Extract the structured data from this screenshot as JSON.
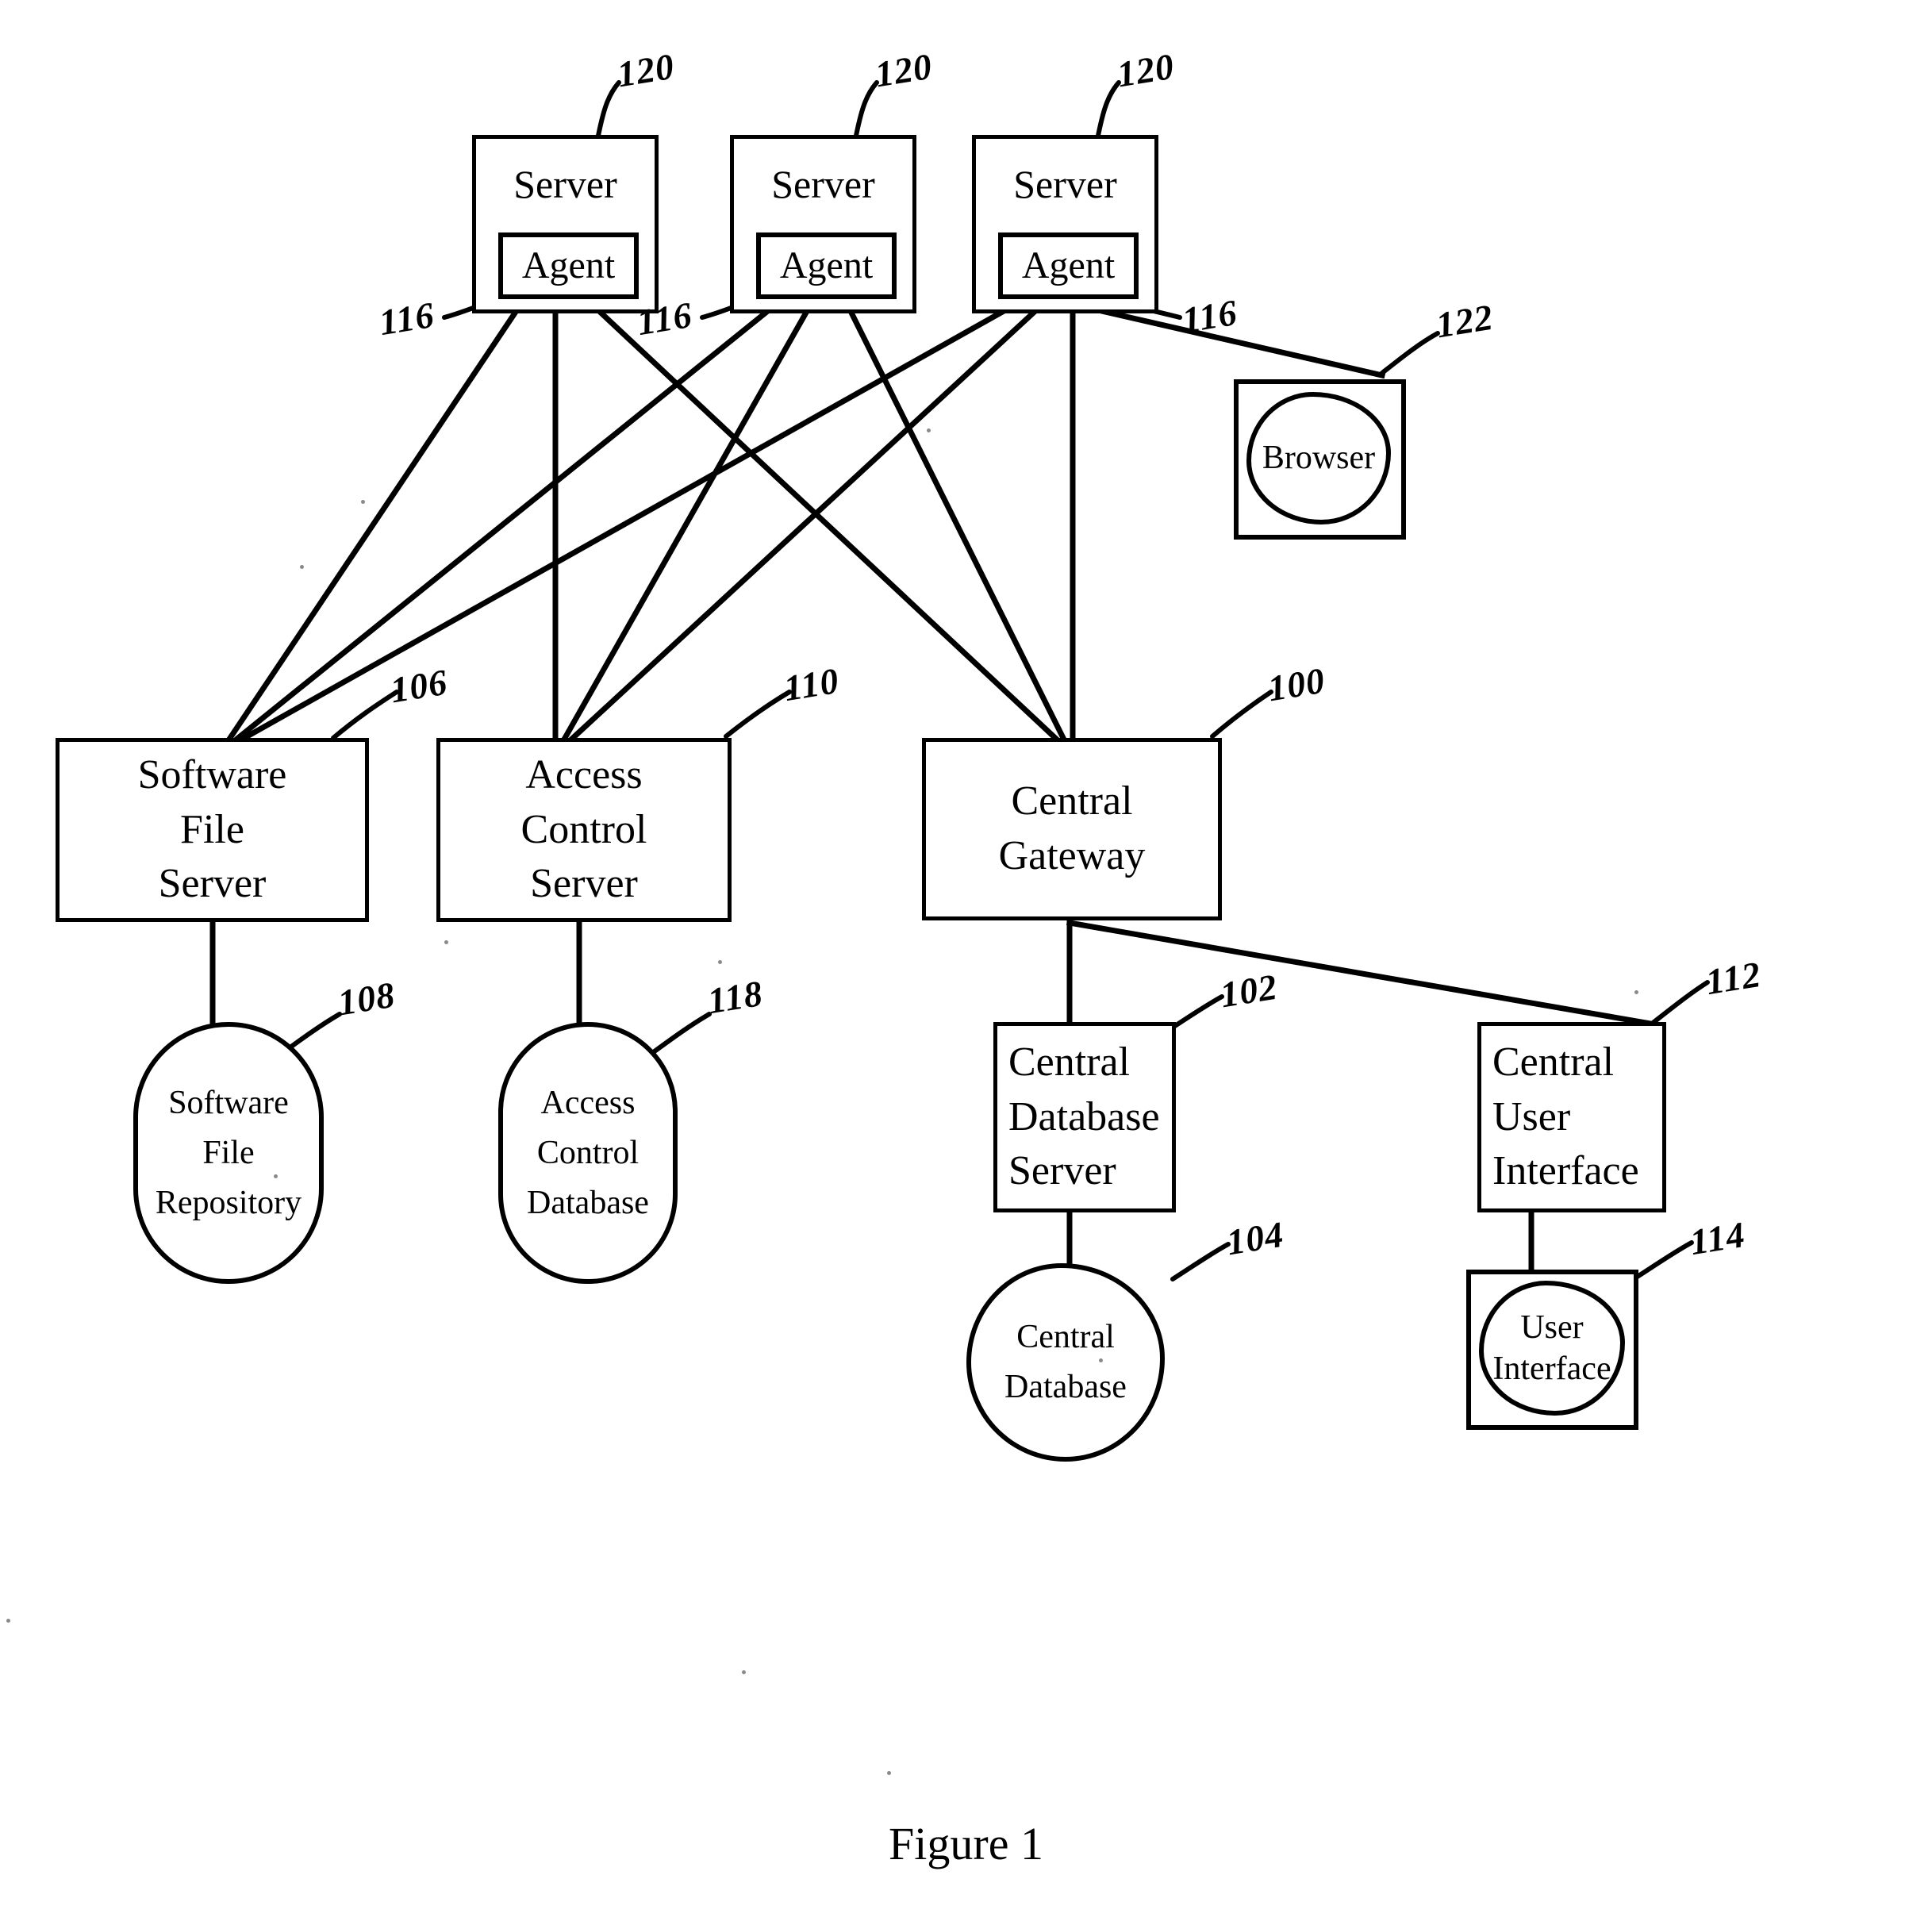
{
  "figure": {
    "caption": "Figure 1",
    "title": "Figure 1 — distributed software deployment system block diagram"
  },
  "servers": [
    {
      "label": "Server",
      "agent_label": "Agent",
      "ref": "120",
      "agent_ref": "116"
    },
    {
      "label": "Server",
      "agent_label": "Agent",
      "ref": "120",
      "agent_ref": "116"
    },
    {
      "label": "Server",
      "agent_label": "Agent",
      "ref": "120",
      "agent_ref": "116"
    }
  ],
  "browser": {
    "label": "Browser",
    "ref": "122"
  },
  "middle_row": [
    {
      "id": "software-file-server",
      "lines": [
        "Software",
        "File",
        "Server"
      ],
      "ref": "106"
    },
    {
      "id": "access-control-server",
      "lines": [
        "Access",
        "Control",
        "Server"
      ],
      "ref": "110"
    },
    {
      "id": "central-gateway",
      "lines": [
        "Central",
        "Gateway"
      ],
      "ref": "100"
    }
  ],
  "stores": [
    {
      "id": "software-file-repository",
      "lines": [
        "Software",
        "File",
        "Repository"
      ],
      "ref": "108"
    },
    {
      "id": "access-control-database",
      "lines": [
        "Access",
        "Control",
        "Database"
      ],
      "ref": "118"
    }
  ],
  "central_database_server": {
    "lines": [
      "Central",
      "Database",
      "Server"
    ],
    "ref": "102"
  },
  "central_database": {
    "lines": [
      "Central",
      "Database"
    ],
    "ref": "104"
  },
  "central_user_interface": {
    "lines": [
      "Central",
      "User",
      "Interface"
    ],
    "ref": "112"
  },
  "user_interface": {
    "lines": [
      "User",
      "Interface"
    ],
    "ref": "114"
  },
  "chart_data": {
    "type": "diagram",
    "title": "Figure 1",
    "nodes": [
      {
        "id": "server-1",
        "label": "Server",
        "ref": "120"
      },
      {
        "id": "agent-1",
        "label": "Agent",
        "ref": "116"
      },
      {
        "id": "server-2",
        "label": "Server",
        "ref": "120"
      },
      {
        "id": "agent-2",
        "label": "Agent",
        "ref": "116"
      },
      {
        "id": "server-3",
        "label": "Server",
        "ref": "120"
      },
      {
        "id": "agent-3",
        "label": "Agent",
        "ref": "116"
      },
      {
        "id": "browser",
        "label": "Browser",
        "ref": "122"
      },
      {
        "id": "software-file-server",
        "label": "Software File Server",
        "ref": "106"
      },
      {
        "id": "access-control-server",
        "label": "Access Control Server",
        "ref": "110"
      },
      {
        "id": "central-gateway",
        "label": "Central Gateway",
        "ref": "100"
      },
      {
        "id": "software-file-repository",
        "label": "Software File Repository",
        "ref": "108"
      },
      {
        "id": "access-control-database",
        "label": "Access Control Database",
        "ref": "118"
      },
      {
        "id": "central-database-server",
        "label": "Central Database Server",
        "ref": "102"
      },
      {
        "id": "central-database",
        "label": "Central Database",
        "ref": "104"
      },
      {
        "id": "central-user-interface",
        "label": "Central User Interface",
        "ref": "112"
      },
      {
        "id": "user-interface",
        "label": "User Interface",
        "ref": "114"
      }
    ],
    "edges": [
      {
        "from": "agent-1",
        "to": "software-file-server"
      },
      {
        "from": "agent-1",
        "to": "access-control-server"
      },
      {
        "from": "agent-1",
        "to": "central-gateway"
      },
      {
        "from": "agent-2",
        "to": "software-file-server"
      },
      {
        "from": "agent-2",
        "to": "access-control-server"
      },
      {
        "from": "agent-2",
        "to": "central-gateway"
      },
      {
        "from": "agent-3",
        "to": "software-file-server"
      },
      {
        "from": "agent-3",
        "to": "access-control-server"
      },
      {
        "from": "agent-3",
        "to": "central-gateway"
      },
      {
        "from": "agent-3",
        "to": "browser"
      },
      {
        "from": "software-file-server",
        "to": "software-file-repository"
      },
      {
        "from": "access-control-server",
        "to": "access-control-database"
      },
      {
        "from": "central-gateway",
        "to": "central-database-server"
      },
      {
        "from": "central-gateway",
        "to": "central-user-interface"
      },
      {
        "from": "central-database-server",
        "to": "central-database"
      },
      {
        "from": "central-user-interface",
        "to": "user-interface"
      }
    ]
  }
}
